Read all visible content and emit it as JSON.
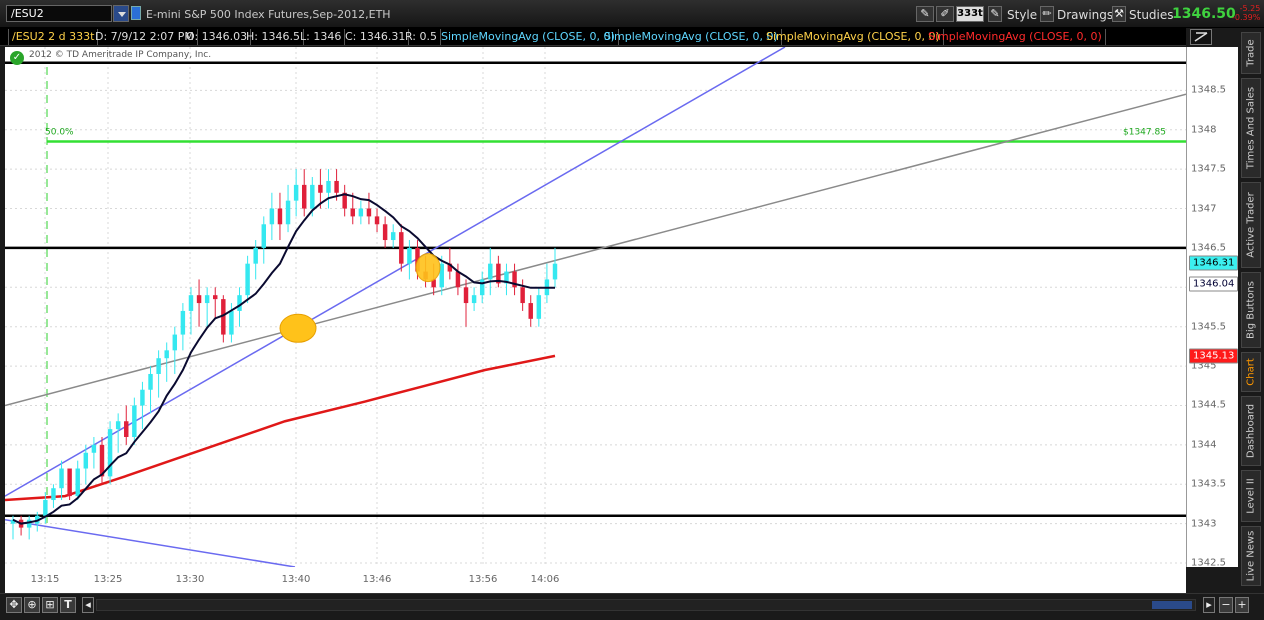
{
  "toolbar": {
    "symbol": "/ESU2",
    "contract_description": "E-mini S&P 500 Index Futures,Sep-2012,ETH",
    "aggregation": "333t",
    "style_label": "Style",
    "drawings_label": "Drawings",
    "studies_label": "Studies",
    "last_price": "1346.50",
    "net_change": "-5.25",
    "net_change_pct": "-0.39%"
  },
  "info_row": {
    "symbol_period": "/ESU2 2 d 333t",
    "date": "D: 7/9/12 2:07 PM",
    "open": "O: 1346.03",
    "high": "H: 1346.5",
    "low": "L: 1346",
    "close": "C: 1346.31",
    "range": "R: 0.5",
    "studies": [
      {
        "label": "SimpleMovingAvg (CLOSE, 0, 0)",
        "color": "#5fd7ff"
      },
      {
        "label": "SimpleMovingAvg (CLOSE, 0, 0)",
        "color": "#5fd7ff"
      },
      {
        "label": "SimpleMovingAvg (CLOSE, 0, 0)",
        "color": "#ffd24a"
      },
      {
        "label": "SimpleMovingAvg (CLOSE, 0, 0)",
        "color": "#ff2b2b"
      }
    ]
  },
  "chart": {
    "copyright": "2012 © TD Ameritrade IP Company, Inc.",
    "fib_label": "50.0%",
    "fib_price_label": "$1347.85",
    "price_bubbles": [
      {
        "text": "1346.31",
        "value": 1346.31,
        "bg": "#3cf0f0",
        "fg": "#000000"
      },
      {
        "text": "1346.04",
        "value": 1346.04,
        "bg": "#ffffff",
        "fg": "#000033"
      },
      {
        "text": "1345.13",
        "value": 1345.13,
        "bg": "#ff1a1a",
        "fg": "#ffffff"
      }
    ]
  },
  "chart_data": {
    "type": "candlestick",
    "y_ticks": [
      "1348.5",
      "1348",
      "1347.5",
      "1347",
      "1346.5",
      "1346",
      "1345.5",
      "1345",
      "1344.5",
      "1344",
      "1343.5",
      "1343",
      "1342.5"
    ],
    "ylim": [
      1342.45,
      1349.05
    ],
    "x_ticks": [
      "13:15",
      "13:25",
      "13:30",
      "13:40",
      "13:46",
      "13:56",
      "14:06"
    ],
    "horizontal_levels": [
      1348.85,
      1346.5,
      1343.1
    ],
    "fib_level": 1347.85,
    "bull_color": "#35e8f0",
    "bear_color": "#e0203a",
    "candles": [
      [
        1343.0,
        1343.1,
        1342.8,
        1343.05
      ],
      [
        1343.05,
        1343.1,
        1342.85,
        1342.95
      ],
      [
        1342.95,
        1343.1,
        1342.8,
        1343.05
      ],
      [
        1343.0,
        1343.15,
        1342.9,
        1343.1
      ],
      [
        1343.1,
        1343.4,
        1343.0,
        1343.3
      ],
      [
        1343.3,
        1343.5,
        1343.2,
        1343.45
      ],
      [
        1343.45,
        1343.8,
        1343.3,
        1343.7
      ],
      [
        1343.7,
        1343.6,
        1343.3,
        1343.35
      ],
      [
        1343.35,
        1343.8,
        1343.3,
        1343.7
      ],
      [
        1343.7,
        1344.0,
        1343.5,
        1343.9
      ],
      [
        1343.9,
        1344.1,
        1343.7,
        1344.0
      ],
      [
        1344.0,
        1344.1,
        1343.5,
        1343.6
      ],
      [
        1343.6,
        1344.3,
        1343.5,
        1344.2
      ],
      [
        1344.2,
        1344.4,
        1343.9,
        1344.3
      ],
      [
        1344.3,
        1344.5,
        1344.0,
        1344.1
      ],
      [
        1344.1,
        1344.6,
        1344.0,
        1344.5
      ],
      [
        1344.5,
        1344.8,
        1344.2,
        1344.7
      ],
      [
        1344.7,
        1345.0,
        1344.4,
        1344.9
      ],
      [
        1344.9,
        1345.2,
        1344.6,
        1345.1
      ],
      [
        1345.1,
        1345.3,
        1344.8,
        1345.2
      ],
      [
        1345.2,
        1345.5,
        1344.9,
        1345.4
      ],
      [
        1345.4,
        1345.8,
        1345.2,
        1345.7
      ],
      [
        1345.7,
        1346.0,
        1345.4,
        1345.9
      ],
      [
        1345.9,
        1346.1,
        1345.5,
        1345.8
      ],
      [
        1345.8,
        1346.0,
        1345.5,
        1345.9
      ],
      [
        1345.9,
        1346.0,
        1345.6,
        1345.85
      ],
      [
        1345.85,
        1345.9,
        1345.3,
        1345.4
      ],
      [
        1345.4,
        1345.8,
        1345.3,
        1345.7
      ],
      [
        1345.7,
        1346.0,
        1345.5,
        1345.9
      ],
      [
        1345.9,
        1346.4,
        1345.8,
        1346.3
      ],
      [
        1346.3,
        1346.6,
        1346.1,
        1346.5
      ],
      [
        1346.5,
        1346.9,
        1346.3,
        1346.8
      ],
      [
        1346.8,
        1347.2,
        1346.6,
        1347.0
      ],
      [
        1347.0,
        1347.2,
        1346.6,
        1346.8
      ],
      [
        1346.8,
        1347.3,
        1346.7,
        1347.1
      ],
      [
        1347.1,
        1347.5,
        1346.9,
        1347.3
      ],
      [
        1347.3,
        1347.5,
        1346.9,
        1347.0
      ],
      [
        1347.0,
        1347.4,
        1346.9,
        1347.3
      ],
      [
        1347.3,
        1347.5,
        1347.0,
        1347.2
      ],
      [
        1347.2,
        1347.5,
        1347.0,
        1347.35
      ],
      [
        1347.35,
        1347.5,
        1347.1,
        1347.2
      ],
      [
        1347.2,
        1347.3,
        1346.9,
        1347.0
      ],
      [
        1347.0,
        1347.2,
        1346.8,
        1346.9
      ],
      [
        1346.9,
        1347.1,
        1346.8,
        1347.0
      ],
      [
        1347.0,
        1347.2,
        1346.8,
        1346.9
      ],
      [
        1346.9,
        1347.0,
        1346.7,
        1346.8
      ],
      [
        1346.8,
        1346.9,
        1346.5,
        1346.6
      ],
      [
        1346.6,
        1346.8,
        1346.5,
        1346.7
      ],
      [
        1346.7,
        1346.8,
        1346.2,
        1346.3
      ],
      [
        1346.3,
        1346.6,
        1346.1,
        1346.5
      ],
      [
        1346.5,
        1346.6,
        1346.1,
        1346.2
      ],
      [
        1346.2,
        1346.4,
        1346.0,
        1346.1
      ],
      [
        1346.1,
        1346.3,
        1345.9,
        1346.0
      ],
      [
        1346.0,
        1346.4,
        1345.9,
        1346.3
      ],
      [
        1346.3,
        1346.5,
        1346.1,
        1346.2
      ],
      [
        1346.2,
        1346.3,
        1345.9,
        1346.0
      ],
      [
        1346.0,
        1346.1,
        1345.5,
        1345.8
      ],
      [
        1345.8,
        1346.0,
        1345.7,
        1345.9
      ],
      [
        1345.9,
        1346.2,
        1345.8,
        1346.1
      ],
      [
        1346.1,
        1346.5,
        1345.9,
        1346.3
      ],
      [
        1346.3,
        1346.4,
        1346.0,
        1346.05
      ],
      [
        1346.05,
        1346.3,
        1345.9,
        1346.2
      ],
      [
        1346.2,
        1346.3,
        1345.9,
        1346.0
      ],
      [
        1346.0,
        1346.1,
        1345.7,
        1345.8
      ],
      [
        1345.8,
        1345.9,
        1345.5,
        1345.6
      ],
      [
        1345.6,
        1346.0,
        1345.5,
        1345.9
      ],
      [
        1345.9,
        1346.3,
        1345.8,
        1346.1
      ],
      [
        1346.1,
        1346.5,
        1346.0,
        1346.3
      ]
    ]
  },
  "right_tabs": [
    "Trade",
    "Times And Sales",
    "Active Trader",
    "Big Buttons",
    "Chart",
    "Dashboard",
    "Level II",
    "Live News"
  ],
  "active_tab": "Chart"
}
